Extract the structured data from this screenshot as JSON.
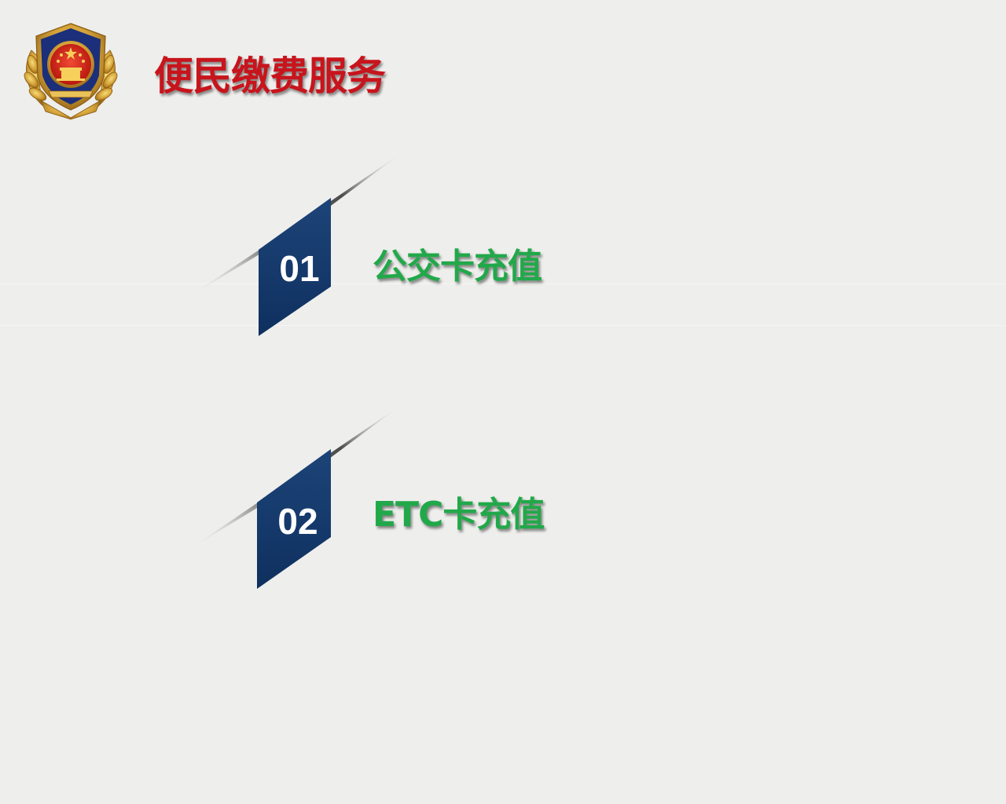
{
  "header": {
    "title": "便民缴费服务",
    "emblem": "police-emblem"
  },
  "menu": {
    "items": [
      {
        "number": "01",
        "label": "公交卡充值"
      },
      {
        "number": "02",
        "label": "ETC卡充值"
      }
    ]
  },
  "colors": {
    "background": "#eeeeec",
    "title": "#c8141c",
    "label": "#22a84a",
    "tab": "#0f3565"
  }
}
